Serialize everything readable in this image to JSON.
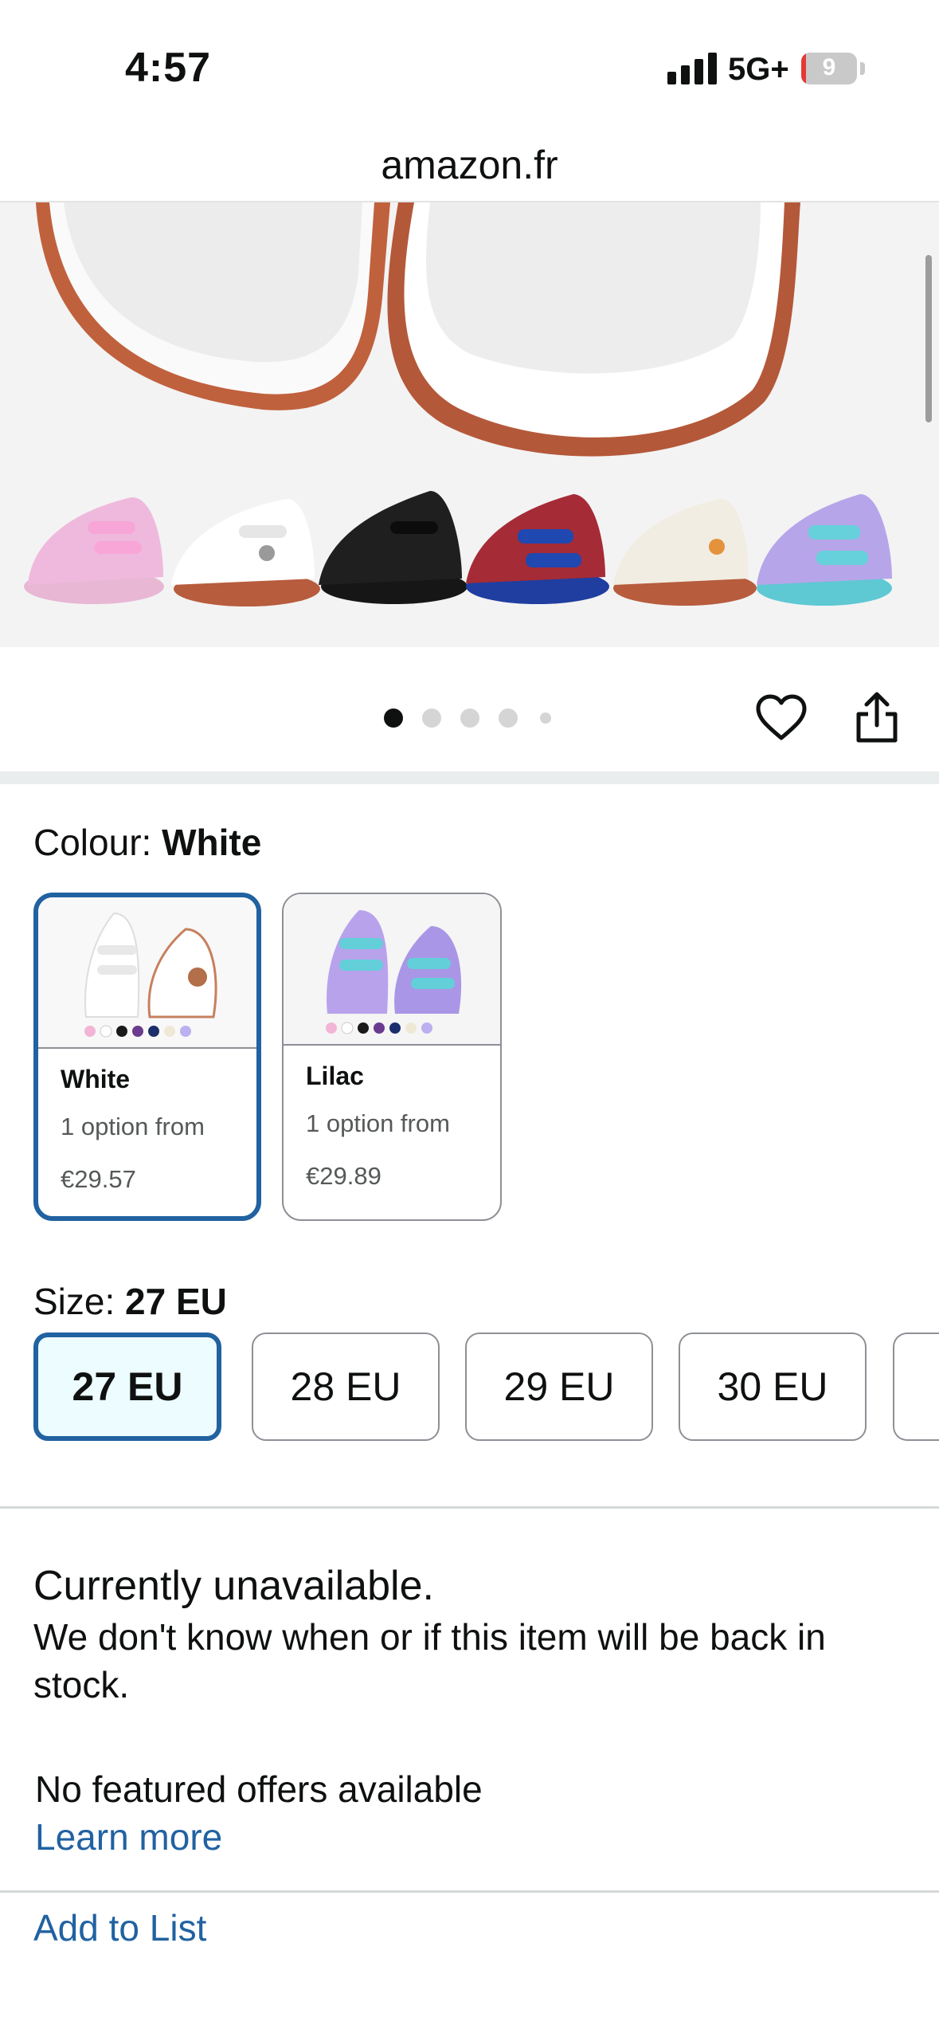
{
  "status_bar": {
    "time": "4:57",
    "network": "5G+",
    "battery": "9",
    "battery_level": 0.09,
    "battery_color": "#e53935"
  },
  "browser": {
    "url": "amazon.fr"
  },
  "gallery": {
    "page_count": 5,
    "active_page": 1,
    "icons": {
      "wishlist": "heart-icon",
      "share": "share-icon"
    }
  },
  "colour": {
    "label": "Colour:",
    "selected": "White",
    "options": [
      {
        "name": "White",
        "availability": "1 option from",
        "price": "€29.57",
        "selected": true
      },
      {
        "name": "Lilac",
        "availability": "1 option from",
        "price": "€29.89",
        "selected": false
      }
    ]
  },
  "size": {
    "label": "Size:",
    "selected": "27 EU",
    "options": [
      "27 EU",
      "28 EU",
      "29 EU",
      "30 EU"
    ]
  },
  "availability": {
    "title": "Currently unavailable.",
    "message": "We don't know when or if this item will be back in stock.",
    "no_offers": "No featured offers available",
    "learn_more": "Learn more"
  },
  "actions": {
    "add_to_list": "Add to List"
  },
  "colors": {
    "link": "#2162a1",
    "selected_border": "#2162a1",
    "selected_bg": "#edfdff"
  }
}
